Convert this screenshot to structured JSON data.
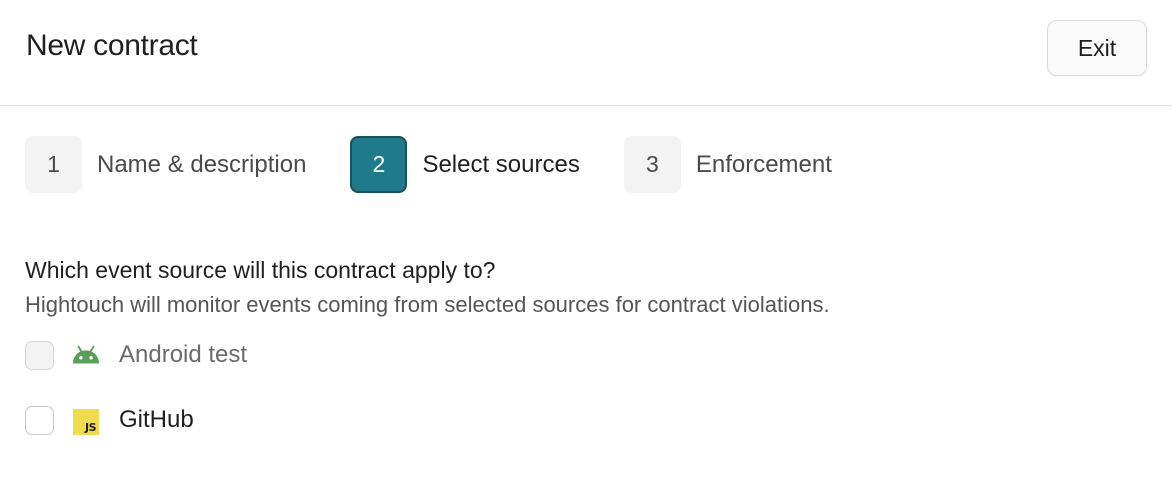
{
  "header": {
    "title": "New contract",
    "exit_label": "Exit"
  },
  "steps": [
    {
      "number": "1",
      "label": "Name & description",
      "active": false
    },
    {
      "number": "2",
      "label": "Select sources",
      "active": true
    },
    {
      "number": "3",
      "label": "Enforcement",
      "active": false
    }
  ],
  "main": {
    "question": "Which event source will this contract apply to?",
    "description": "Hightouch will monitor events coming from selected sources for contract violations.",
    "sources": [
      {
        "label": "Android test",
        "icon": "android-icon",
        "checked": false,
        "disabled": true,
        "icon_color": "#5a9e5a"
      },
      {
        "label": "GitHub",
        "icon": "javascript-icon",
        "icon_text": "JS",
        "checked": false,
        "disabled": false,
        "icon_color": "#f0db4f"
      }
    ]
  },
  "colors": {
    "accent": "#1f7a8c",
    "accent_border": "#1b4f5c"
  }
}
